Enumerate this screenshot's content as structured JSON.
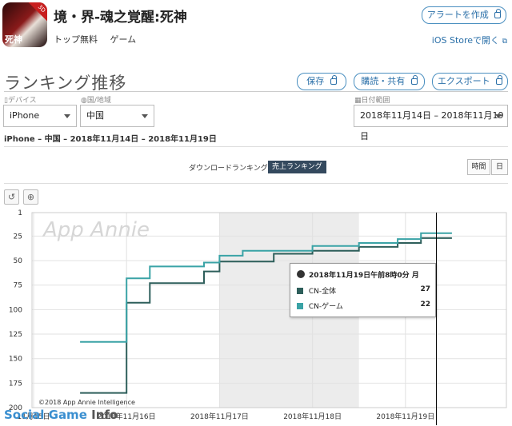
{
  "app": {
    "title": "境・界-魂之覚醒:死神",
    "icon_tag": "死神",
    "icon_badge": "3D",
    "meta": [
      "トップ無料",
      "ゲーム"
    ]
  },
  "header_buttons": {
    "alert": "アラートを作成",
    "store": "iOS Storeで開く"
  },
  "page": {
    "title": "ランキング推移",
    "save": "保存",
    "purchase_share": "購読・共有",
    "export": "エクスポート"
  },
  "filters": {
    "device_label": "デバイス",
    "device_value": "iPhone",
    "country_label": "国/地域",
    "country_value": "中国",
    "date_label": "日付範囲",
    "date_value": "2018年11月14日 – 2018年11月19日"
  },
  "subtitle": "iPhone – 中国 – 2018年11月14日 – 2018年11月19日",
  "tabs": {
    "download": "ダウンロードランキング",
    "revenue": "売上ランキング",
    "hour": "時間",
    "day": "日"
  },
  "tools": {
    "reset": "↺",
    "zoom": "⊕"
  },
  "tooltip": {
    "header": "2018年11月19日午前8時0分 月",
    "rows": [
      {
        "label": "CN-全体",
        "value": "27",
        "color": "#2e5f5b"
      },
      {
        "label": "CN-ゲーム",
        "value": "22",
        "color": "#3aa3a6"
      }
    ]
  },
  "watermark_app": "App Annie",
  "copyright": "©2018 App Annie Intelligence",
  "watermark_site": {
    "a": "Social Game",
    "b": "Info"
  },
  "chart_data": {
    "type": "line",
    "ylabel": "",
    "y_reversed": true,
    "ylim": [
      200,
      1
    ],
    "yticks": [
      1,
      25,
      50,
      75,
      100,
      125,
      150,
      175,
      200
    ],
    "xticks": [
      "11月15日",
      "2018年11月16日",
      "2018年11月17日",
      "2018年11月18日",
      "2018年11月19日"
    ],
    "series": [
      {
        "name": "CN-全体",
        "color": "#2e5f5b",
        "points": [
          [
            "11/15 12:00",
            185
          ],
          [
            "11/16 00:00",
            185
          ],
          [
            "11/16 00:00",
            93
          ],
          [
            "11/16 06:00",
            93
          ],
          [
            "11/16 06:00",
            73
          ],
          [
            "11/16 20:00",
            73
          ],
          [
            "11/16 20:00",
            61
          ],
          [
            "11/17 00:00",
            61
          ],
          [
            "11/17 00:00",
            51
          ],
          [
            "11/17 14:00",
            51
          ],
          [
            "11/17 14:00",
            43
          ],
          [
            "11/18 00:00",
            43
          ],
          [
            "11/18 00:00",
            40
          ],
          [
            "11/18 12:00",
            40
          ],
          [
            "11/18 12:00",
            36
          ],
          [
            "11/18 22:00",
            36
          ],
          [
            "11/18 22:00",
            32
          ],
          [
            "11/19 04:00",
            32
          ],
          [
            "11/19 04:00",
            27
          ],
          [
            "11/19 08:00",
            27
          ],
          [
            "11/19 08:00",
            27
          ],
          [
            "11/19 12:00",
            27
          ]
        ]
      },
      {
        "name": "CN-ゲーム",
        "color": "#3aa3a6",
        "points": [
          [
            "11/15 12:00",
            133
          ],
          [
            "11/16 00:00",
            133
          ],
          [
            "11/16 00:00",
            68
          ],
          [
            "11/16 06:00",
            68
          ],
          [
            "11/16 06:00",
            56
          ],
          [
            "11/16 20:00",
            56
          ],
          [
            "11/16 20:00",
            52
          ],
          [
            "11/17 00:00",
            52
          ],
          [
            "11/17 00:00",
            45
          ],
          [
            "11/17 06:00",
            45
          ],
          [
            "11/17 06:00",
            40
          ],
          [
            "11/18 00:00",
            40
          ],
          [
            "11/18 00:00",
            35
          ],
          [
            "11/18 12:00",
            35
          ],
          [
            "11/18 12:00",
            32
          ],
          [
            "11/18 22:00",
            32
          ],
          [
            "11/18 22:00",
            28
          ],
          [
            "11/19 04:00",
            28
          ],
          [
            "11/19 04:00",
            22
          ],
          [
            "11/19 12:00",
            22
          ]
        ]
      }
    ],
    "highlight_range": [
      "11/17 00:00",
      "11/18 12:00"
    ],
    "current_time": "11/19 08:00",
    "grid": true
  }
}
